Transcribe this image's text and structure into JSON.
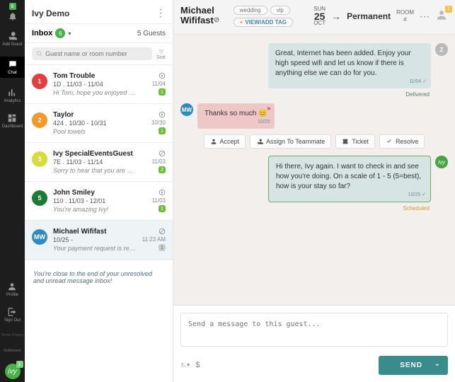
{
  "rail": {
    "items": [
      {
        "name": "bell",
        "badge": "6",
        "badgeColor": "#4ab04a"
      },
      {
        "name": "add-guest",
        "label": "Add Guest"
      },
      {
        "name": "chat",
        "label": "Chat"
      },
      {
        "name": "analytics",
        "label": "Analytics"
      },
      {
        "name": "dashboard",
        "label": "Dashboard"
      }
    ],
    "bottom": [
      {
        "name": "profile",
        "label": "Profile"
      },
      {
        "name": "signout",
        "label": "Sign Out"
      }
    ],
    "legal": "Terms  Privacy",
    "brand": "GoMoment",
    "logo_badge": "1"
  },
  "inbox": {
    "property": "Ivy Demo",
    "tab": "Inbox",
    "tab_count": "6",
    "guest_count": "5 Guests",
    "search_placeholder": "Guest name or room number",
    "sort_label": "Sort",
    "items": [
      {
        "color": "#e33f3f",
        "avatar": "1",
        "name": "Tom Trouble",
        "sub": "1D . 11/03 - 11/04",
        "preview": "Hi Tom, hope you enjoyed yo...",
        "time": "11/04",
        "badge": "1",
        "badgeCls": "",
        "status": "pending"
      },
      {
        "color": "#f09a2e",
        "avatar": "2",
        "name": "Taylor",
        "sub": "424 . 10/30 - 10/31",
        "preview": "Pool towels",
        "time": "10/30",
        "badge": "1",
        "badgeCls": "",
        "status": "pending"
      },
      {
        "color": "#d7db3e",
        "avatar": "3",
        "name": "Ivy SpecialEventsGuest",
        "sub": "7E . 11/03 - 11/14",
        "preview": "Sorry to hear that you are ex...",
        "time": "11/03",
        "badge": "2",
        "badgeCls": "",
        "status": "blocked"
      },
      {
        "color": "#1f7a33",
        "avatar": "5",
        "name": "John Smiley",
        "sub": "110 . 11/03 - 12/01",
        "preview": "You're amazing Ivy!",
        "time": "11/03",
        "badge": "1",
        "badgeCls": "",
        "status": "pending"
      },
      {
        "color": "#2e8bbf",
        "avatar": "MW",
        "name": "Michael Wififast",
        "sub": "10/25 -",
        "preview": "Your payment request is read...",
        "time": "11:23 AM",
        "badge": "1",
        "badgeCls": "gray",
        "status": "blocked",
        "selected": true
      }
    ],
    "end_note": "You're close to the end of your unresolved and unread message inbox!"
  },
  "header": {
    "guest_name": "Michael Wififast",
    "tags": [
      "wedding",
      "vip"
    ],
    "add_tag": "VIEW/ADD TAG",
    "checkin_day": "SUN",
    "checkin_date": "25",
    "checkin_month": "OCT",
    "checkout": "Permanent",
    "room_label": "ROOM",
    "room_value": "#",
    "user_badge": "1"
  },
  "chat": {
    "messages": [
      {
        "role": "agent",
        "avatar": "Z",
        "text": "Great, Internet has been added.  Enjoy your high speed wifi and let us know if there is anything else we can do for you.",
        "time": "11/04",
        "status": "Delivered"
      },
      {
        "role": "guest",
        "avatar": "MW",
        "text": "Thanks so much 😊",
        "time": "10/25",
        "flag": true
      },
      {
        "role": "auto",
        "avatar": "ivy",
        "text": "Hi there, Ivy again. I want to check in and see how you're doing. On a scale of 1 - 5 (5=best), how is your stay so far?",
        "time": "10/25",
        "status": "Scheduled"
      }
    ],
    "actions": [
      {
        "icon": "accept",
        "label": "Accept"
      },
      {
        "icon": "assign",
        "label": "Assign To Teammate"
      },
      {
        "icon": "ticket",
        "label": "Ticket"
      },
      {
        "icon": "resolve",
        "label": "Resolve"
      }
    ],
    "composer_placeholder": "Send a message to this guest...",
    "send_label": "SEND"
  }
}
